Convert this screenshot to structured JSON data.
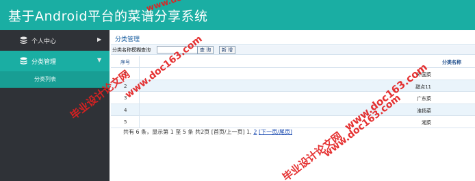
{
  "header": {
    "title": "基于Android平台的菜谱分享系统"
  },
  "sidebar": {
    "items": [
      {
        "label": "个人中心",
        "icon": "stack-icon",
        "arrow": "▶"
      },
      {
        "label": "分类管理",
        "icon": "stack-icon",
        "arrow": "▼"
      }
    ],
    "sub_items": [
      {
        "label": "分类列表"
      }
    ]
  },
  "breadcrumb": "分类管理",
  "search": {
    "label": "分类名称模糊查询",
    "value": "",
    "query_label": "查 询",
    "add_label": "新 增"
  },
  "table": {
    "headers": [
      "序号",
      "分类名称"
    ],
    "rows": [
      {
        "index": "1",
        "name": "外国菜"
      },
      {
        "index": "2",
        "name": "甜点11"
      },
      {
        "index": "3",
        "name": "广东菜"
      },
      {
        "index": "4",
        "name": "淮扬菜"
      },
      {
        "index": "5",
        "name": "湘菜"
      }
    ]
  },
  "pager": {
    "summary": "共有 6 条，显示第 1 至 5 条   共2页    [首页/上一页] 1,",
    "page2": "2",
    "next": "[下一页/尾页]"
  },
  "watermarks": [
    "毕业设计论文网",
    "www.doc163.com",
    "www.doc163.com",
    "毕业设计论文网",
    "www.doc163.com",
    "www.doc163.com"
  ],
  "colors": {
    "accent": "#1aaea3",
    "sidebar": "#2f3237",
    "watermark": "#e32020",
    "link": "#1a4ab0"
  }
}
